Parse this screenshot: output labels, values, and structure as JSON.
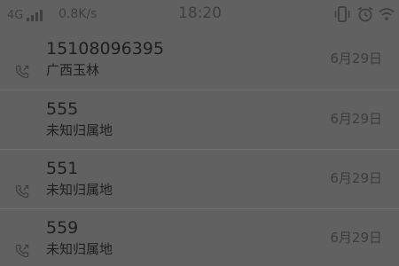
{
  "status_bar": {
    "network": "4G",
    "speed": "0.8K/s",
    "time": "18:20",
    "icons": [
      "signal-bars-icon",
      "vibrate-icon",
      "alarm-icon",
      "wifi-icon"
    ]
  },
  "calls": [
    {
      "number": "15108096395",
      "location": "广西玉林",
      "date": "6月29日",
      "icon": "outgoing-call-icon"
    },
    {
      "number": "555",
      "location": "未知归属地",
      "date": "6月29日",
      "icon": ""
    },
    {
      "number": "551",
      "location": "未知归属地",
      "date": "6月29日",
      "icon": "outgoing-call-icon"
    },
    {
      "number": "559",
      "location": "未知归属地",
      "date": "6月29日",
      "icon": "outgoing-call-icon"
    }
  ],
  "colors": {
    "background": "#616161",
    "primary_text": "#1e1e1e",
    "secondary_text": "#3c3c3c",
    "divider": "#6e6e6e"
  }
}
